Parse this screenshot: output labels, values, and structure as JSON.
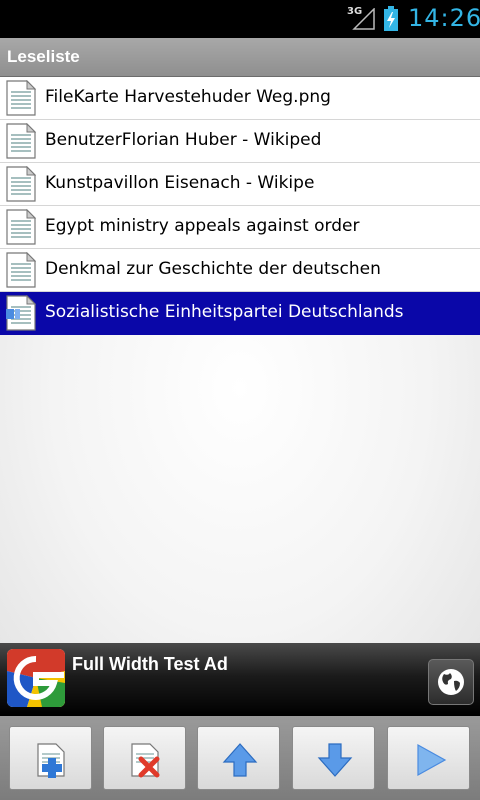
{
  "status_bar": {
    "network": "3G",
    "time": "14:26",
    "accent_color": "#33b5e5"
  },
  "title_bar": {
    "title": "Leseliste"
  },
  "list": {
    "items": [
      {
        "label": "FileKarte Harvestehuder Weg.png",
        "icon": "document-icon",
        "selected": false
      },
      {
        "label": "BenutzerFlorian Huber - Wikiped",
        "icon": "document-icon",
        "selected": false
      },
      {
        "label": "Kunstpavillon Eisenach - Wikipe",
        "icon": "document-icon",
        "selected": false
      },
      {
        "label": "Egypt ministry appeals against order",
        "icon": "document-icon",
        "selected": false
      },
      {
        "label": "Denkmal zur Geschichte der deutschen",
        "icon": "document-icon",
        "selected": false
      },
      {
        "label": "Sozialistische Einheitspartei Deutschlands",
        "icon": "document-loading-icon",
        "selected": true
      }
    ],
    "selected_color": "#0a07a8"
  },
  "ad": {
    "text": "Full Width Test Ad",
    "logo_icon": "google-g-logo-icon",
    "action_icon": "globe-icon"
  },
  "toolbar": {
    "buttons": [
      {
        "name": "add-document-button",
        "icon": "document-add-icon"
      },
      {
        "name": "delete-document-button",
        "icon": "document-delete-icon"
      },
      {
        "name": "move-up-button",
        "icon": "arrow-up-icon"
      },
      {
        "name": "move-down-button",
        "icon": "arrow-down-icon"
      },
      {
        "name": "play-button",
        "icon": "play-icon"
      }
    ]
  }
}
